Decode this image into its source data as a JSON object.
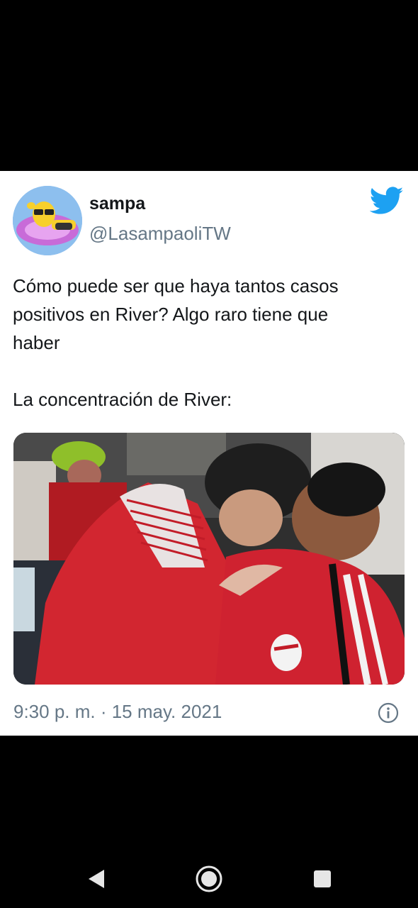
{
  "tweet": {
    "display_name": "sampa",
    "handle": "@LasampaoliTW",
    "text_paragraphs": [
      "Cómo puede ser que haya tantos casos\npositivos en River? Algo raro tiene que\nhaber",
      "La concentración de River:"
    ],
    "timestamp": "9:30 p. m. · 15 may. 2021",
    "brand_color": "#1da1f2"
  },
  "icons": {
    "logo": "twitter-bird-icon",
    "info": "info-icon"
  },
  "navigation": {
    "buttons": [
      "back-icon",
      "home-icon",
      "recents-icon"
    ]
  }
}
